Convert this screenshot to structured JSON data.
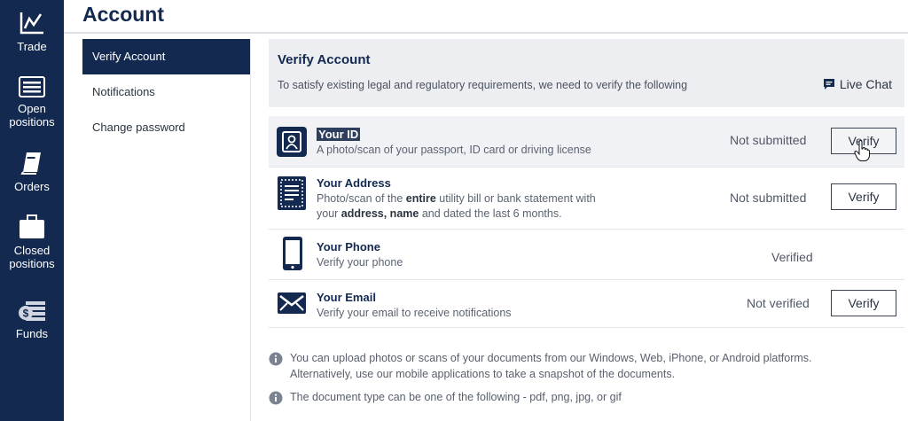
{
  "nav": {
    "items": [
      {
        "label": "Trade",
        "icon": "chart-line-icon"
      },
      {
        "label": "Open positions",
        "icon": "list-icon"
      },
      {
        "label": "Orders",
        "icon": "book-icon"
      },
      {
        "label": "Closed positions",
        "icon": "briefcase-icon"
      },
      {
        "label": "Funds",
        "icon": "money-stack-icon"
      }
    ]
  },
  "header": {
    "title": "Account"
  },
  "menu": {
    "items": [
      {
        "label": "Verify Account",
        "active": true
      },
      {
        "label": "Notifications",
        "active": false
      },
      {
        "label": "Change password",
        "active": false
      }
    ]
  },
  "panel": {
    "title": "Verify Account",
    "description": "To satisfy existing legal and regulatory requirements, we need to verify the following",
    "live_chat": "Live Chat"
  },
  "rows": [
    {
      "title": "Your ID",
      "desc": "A photo/scan of your passport, ID card or driving license",
      "status": "Not submitted",
      "button": "Verify",
      "icon": "id-badge-icon"
    },
    {
      "title": "Your Address",
      "desc_parts": [
        "Photo/scan of the ",
        "entire",
        " utility bill or bank statement with",
        "your ",
        "address, name",
        " and dated the last 6 months."
      ],
      "status": "Not submitted",
      "button": "Verify",
      "icon": "document-icon"
    },
    {
      "title": "Your Phone",
      "desc": "Verify your phone",
      "status": "Verified",
      "icon": "phone-icon"
    },
    {
      "title": "Your Email",
      "desc": "Verify your email to receive notifications",
      "status": "Not verified",
      "button": "Verify",
      "icon": "envelope-icon"
    }
  ],
  "notes": {
    "upload_line1": "You can upload photos or scans of your documents from our Windows, Web, iPhone, or Android platforms.",
    "upload_line2": "Alternatively, use our mobile applications to take a snapshot of the documents.",
    "types": "The document type can be one of the following -  pdf, png, jpg, or gif"
  },
  "colors": {
    "nav_bg": "#13294f",
    "panel_header_bg": "#eceef1",
    "accent": "#13294f"
  }
}
